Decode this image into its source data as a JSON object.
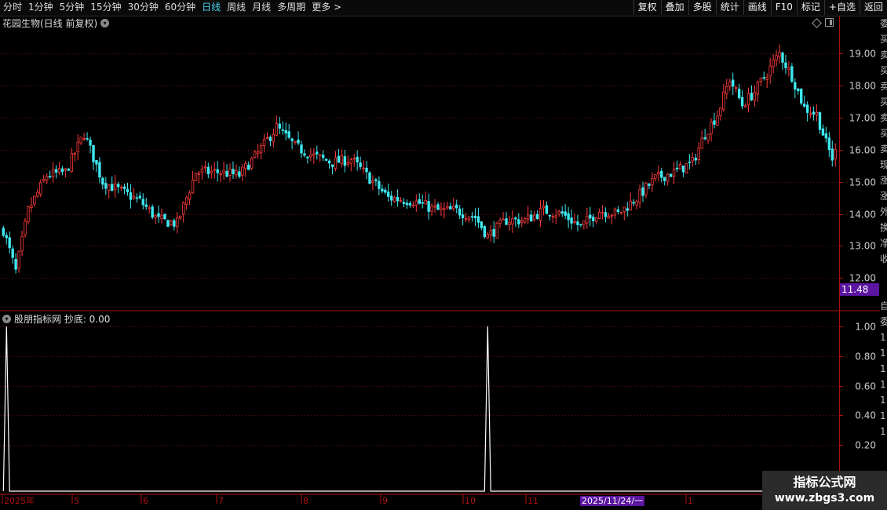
{
  "toolbar": {
    "periods": [
      "分时",
      "1分钟",
      "5分钟",
      "15分钟",
      "30分钟",
      "60分钟",
      "日线",
      "周线",
      "月线",
      "多周期",
      "更多 >"
    ],
    "active_period": "日线",
    "buttons": [
      "复权",
      "叠加",
      "多股",
      "统计",
      "画线",
      "F10",
      "标记",
      "+自选",
      "返回"
    ]
  },
  "stock": {
    "title": "花园生物(日线 前复权)",
    "last_price": "11.48"
  },
  "indicator": {
    "title": "股朋指标网 抄底: 0.00"
  },
  "colors": {
    "up": "#ff3b3b",
    "down": "#3ee8f0",
    "axis": "#b01010",
    "grid": "#6a0f0f",
    "label": "#cccccc"
  },
  "price_axis": {
    "ticks": [
      19.0,
      18.0,
      17.0,
      16.0,
      15.0,
      14.0,
      13.0,
      12.0
    ],
    "labels": [
      "19.00",
      "18.00",
      "17.00",
      "16.00",
      "15.00",
      "14.00",
      "13.00",
      "12.00"
    ]
  },
  "indicator_axis": {
    "ticks": [
      1.0,
      0.8,
      0.6,
      0.4,
      0.2
    ],
    "labels": [
      "1.00",
      "0.80",
      "0.60",
      "0.40",
      "0.20"
    ]
  },
  "time_axis": {
    "labels": [
      "2025年",
      "5",
      "6",
      "7",
      "8",
      "9",
      "10",
      "11",
      "1"
    ]
  },
  "cursor_date": "2025/11/24/一",
  "right_strip_chars": [
    "委",
    "买",
    "卖",
    "买",
    "卖",
    "买",
    "卖",
    "买",
    "卖",
    "现",
    "涨",
    "涨",
    "外",
    "换",
    "净",
    "收",
    "",
    "",
    "自",
    "委",
    "1",
    "1",
    "1",
    "1",
    "1",
    "1",
    "1"
  ],
  "watermark": {
    "line1": "指标公式网",
    "line2": "www.zbgs3.com"
  },
  "chart_data": {
    "type": "candlestick",
    "title": "花园生物(日线 前复权)",
    "ylim": [
      11.5,
      19.8
    ],
    "anchors": [
      [
        0,
        13.5
      ],
      [
        4,
        12.2
      ],
      [
        8,
        14.1
      ],
      [
        14,
        15.2
      ],
      [
        20,
        15.3
      ],
      [
        26,
        16.5
      ],
      [
        32,
        15.0
      ],
      [
        38,
        14.7
      ],
      [
        44,
        14.4
      ],
      [
        50,
        13.8
      ],
      [
        56,
        13.7
      ],
      [
        62,
        15.3
      ],
      [
        70,
        15.3
      ],
      [
        76,
        15.2
      ],
      [
        82,
        15.9
      ],
      [
        88,
        16.7
      ],
      [
        94,
        16.1
      ],
      [
        100,
        15.8
      ],
      [
        106,
        15.6
      ],
      [
        112,
        15.7
      ],
      [
        118,
        15.1
      ],
      [
        124,
        14.5
      ],
      [
        132,
        14.4
      ],
      [
        140,
        14.1
      ],
      [
        146,
        14.1
      ],
      [
        152,
        13.9
      ],
      [
        156,
        13.3
      ],
      [
        162,
        13.8
      ],
      [
        168,
        13.8
      ],
      [
        174,
        14.1
      ],
      [
        180,
        14.0
      ],
      [
        186,
        13.6
      ],
      [
        192,
        14.1
      ],
      [
        198,
        14.0
      ],
      [
        204,
        14.5
      ],
      [
        210,
        15.1
      ],
      [
        216,
        15.3
      ],
      [
        222,
        15.6
      ],
      [
        226,
        16.5
      ],
      [
        230,
        17.1
      ],
      [
        234,
        18.2
      ],
      [
        238,
        17.4
      ],
      [
        242,
        17.8
      ],
      [
        246,
        18.4
      ],
      [
        250,
        19.0
      ],
      [
        254,
        18.3
      ],
      [
        258,
        17.3
      ],
      [
        262,
        17.1
      ],
      [
        265,
        16.2
      ],
      [
        268,
        15.5
      ]
    ],
    "n_candles": 269,
    "last_close": 16.0,
    "signal": {
      "name": "抄底",
      "peaks_at_candle": [
        1,
        156
      ],
      "peak_value": 1.0
    }
  }
}
